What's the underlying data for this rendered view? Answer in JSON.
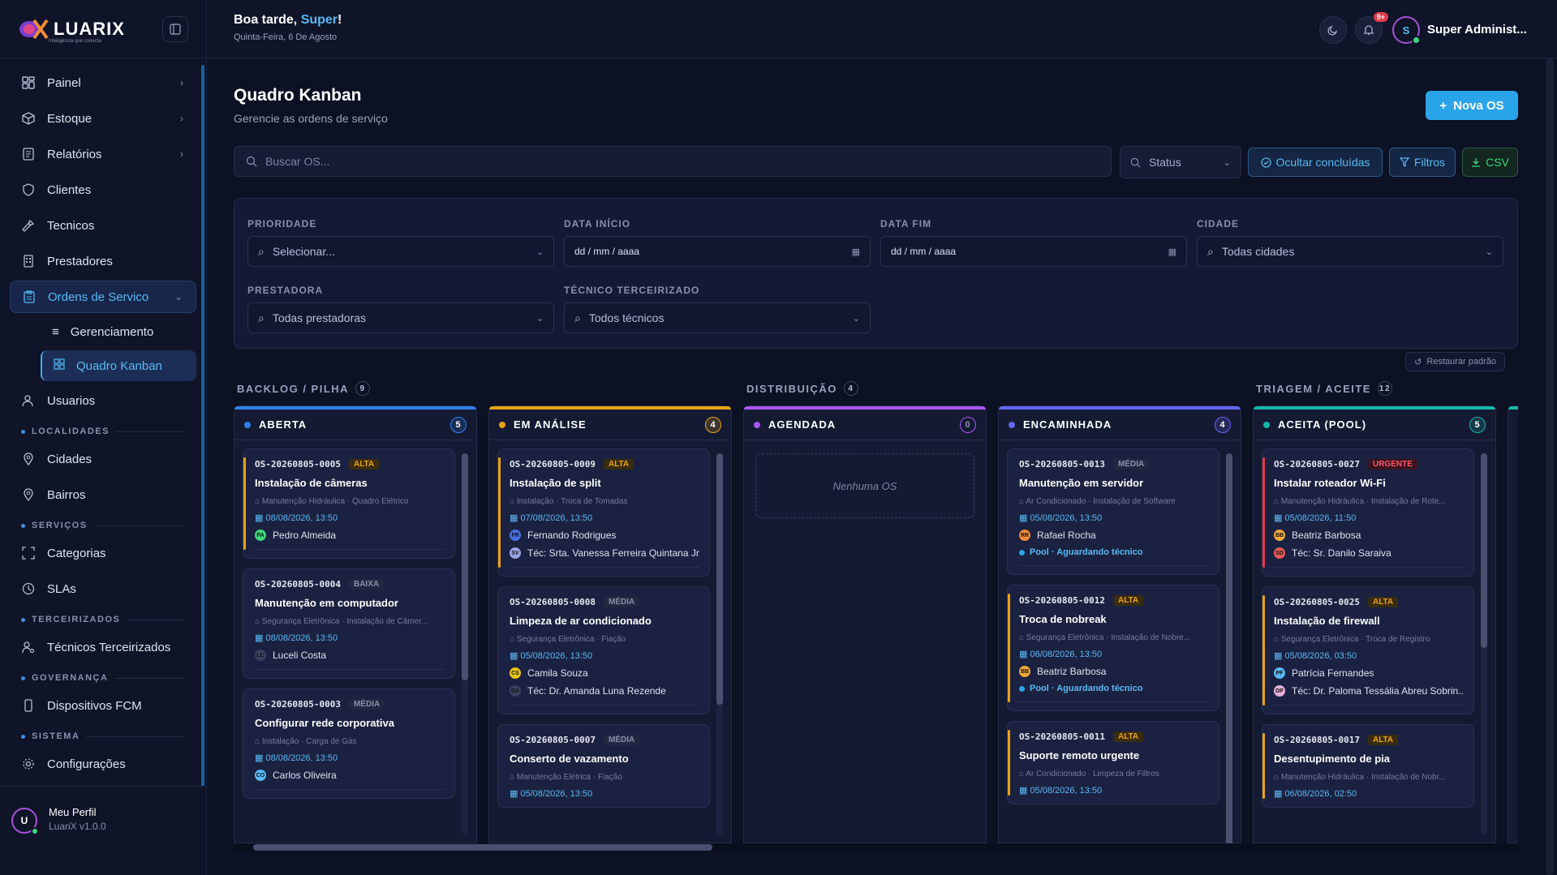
{
  "app": {
    "logo_text": "LUARIX",
    "logo_tagline": "Inteligência que conecta"
  },
  "header": {
    "greeting_prefix": "Boa tarde, ",
    "greeting_name": "Super",
    "greeting_suffix": "!",
    "date": "Quinta-Feira, 6 De Agosto",
    "notif_badge": "9+",
    "user_initial": "S",
    "user_name": "Super Administ..."
  },
  "sidebar": {
    "items": [
      {
        "label": "Painel",
        "icon": "dashboard-icon"
      },
      {
        "label": "Estoque",
        "icon": "box-icon"
      },
      {
        "label": "Relatórios",
        "icon": "report-icon"
      },
      {
        "label": "Clientes",
        "icon": "shield-icon"
      },
      {
        "label": "Tecnicos",
        "icon": "wrench-icon"
      },
      {
        "label": "Prestadores",
        "icon": "building-icon"
      },
      {
        "label": "Ordens de Servico",
        "icon": "clipboard-icon"
      }
    ],
    "subitems": [
      {
        "label": "Gerenciamento",
        "icon": "list-icon"
      },
      {
        "label": "Quadro Kanban",
        "icon": "kanban-icon"
      }
    ],
    "usuarios": "Usuarios",
    "sections": {
      "localidades": "LOCALIDADES",
      "servicos": "SERVIÇOS",
      "terceirizados": "TERCEIRIZADOS",
      "governanca": "GOVERNANÇA",
      "sistema": "SISTEMA"
    },
    "localidades_items": [
      "Cidades",
      "Bairros"
    ],
    "servicos_items": [
      "Categorias",
      "SLAs"
    ],
    "terceirizados_items": [
      "Técnicos Terceirizados"
    ],
    "governanca_items": [
      "Dispositivos FCM"
    ],
    "sistema_items": [
      "Configurações"
    ],
    "profile": {
      "initial": "U",
      "name": "Meu Perfil",
      "version": "LuariX v1.0.0"
    }
  },
  "page": {
    "title": "Quadro Kanban",
    "subtitle": "Gerencie as ordens de serviço",
    "new_button": "Nova OS",
    "search_placeholder": "Buscar OS...",
    "status_label": "Status",
    "hide_done": "Ocultar concluídas",
    "filters_btn": "Filtros",
    "csv_btn": "CSV",
    "restore": "Restaurar padrão"
  },
  "filters": {
    "prioridade": {
      "label": "PRIORIDADE",
      "value": "Selecionar..."
    },
    "data_inicio": {
      "label": "DATA INÍCIO",
      "value": "dd / mm / aaaa"
    },
    "data_fim": {
      "label": "DATA FIM",
      "value": "dd / mm / aaaa"
    },
    "cidade": {
      "label": "CIDADE",
      "value": "Todas cidades"
    },
    "prestadora": {
      "label": "PRESTADORA",
      "value": "Todas prestadoras"
    },
    "tecnico": {
      "label": "TÉCNICO TERCEIRIZADO",
      "value": "Todos técnicos"
    }
  },
  "groups": [
    {
      "label": "BACKLOG / PILHA",
      "count": "9"
    },
    {
      "label": "DISTRIBUIÇÃO",
      "count": "4"
    },
    {
      "label": "TRIAGEM / ACEITE",
      "count": "12"
    }
  ],
  "colors": {
    "accent": "#2aa4e9",
    "alta": "#e8a317",
    "urgente": "#e23b4a",
    "media": "#8a8fb0",
    "baixa": "#8a8fb0"
  },
  "columns": [
    {
      "title": "ABERTA",
      "count": "5",
      "color": "#2f80ed",
      "cards": [
        {
          "id": "OS-20260805-0005",
          "prio": "ALTA",
          "title": "Instalação de câmeras",
          "tags": "Manutenção Hidráulica · Quadro Elétrico",
          "date": "08/08/2026, 13:50",
          "person": "Pedro Almeida",
          "pinit": "PA",
          "pcolor": "#3ed67e"
        },
        {
          "id": "OS-20260805-0004",
          "prio": "BAIXA",
          "title": "Manutenção em computador",
          "tags": "Segurança Eletrônica · Instalação de Câmer...",
          "date": "08/08/2026, 13:50",
          "person": "Luceli Costa",
          "pinit": "LC",
          "pcolor": "#3b4060"
        },
        {
          "id": "OS-20260805-0003",
          "prio": "MÉDIA",
          "title": "Configurar rede corporativa",
          "tags": "Instalação · Carga de Gás",
          "date": "08/08/2026, 13:50",
          "person": "Carlos Oliveira",
          "pinit": "CO",
          "pcolor": "#5ab9f5"
        }
      ]
    },
    {
      "title": "EM ANÁLISE",
      "count": "4",
      "color": "#e8a317",
      "cards": [
        {
          "id": "OS-20260805-0009",
          "prio": "ALTA",
          "title": "Instalação de split",
          "tags": "Instalação · Troca de Tomadas",
          "date": "07/08/2026, 13:50",
          "person": "Fernando Rodrigues",
          "pinit": "FR",
          "pcolor": "#4a6ee0",
          "tec": "Téc: Srta. Vanessa Ferreira Quintana Jr.",
          "tinit": "SV",
          "tcolor": "#9aa6e8"
        },
        {
          "id": "OS-20260805-0008",
          "prio": "MÉDIA",
          "title": "Limpeza de ar condicionado",
          "tags": "Segurança Eletrônica · Fiação",
          "date": "05/08/2026, 13:50",
          "person": "Camila Souza",
          "pinit": "CS",
          "pcolor": "#e8c417",
          "tec": "Téc: Dr. Amanda Luna Rezende",
          "tinit": "DA",
          "tcolor": "#3b4060"
        },
        {
          "id": "OS-20260805-0007",
          "prio": "MÉDIA",
          "title": "Conserto de vazamento",
          "tags": "Manutenção Elétrica · Fiação",
          "date": "05/08/2026, 13:50",
          "person": "",
          "pinit": "",
          "pcolor": "#3b4060"
        }
      ]
    },
    {
      "title": "AGENDADA",
      "count": "0",
      "color": "#a855f7",
      "empty": "Nenhuma OS",
      "cards": []
    },
    {
      "title": "ENCAMINHADA",
      "count": "4",
      "color": "#6366f1",
      "cards": [
        {
          "id": "OS-20260805-0013",
          "prio": "MÉDIA",
          "title": "Manutenção em servidor",
          "tags": "Ar Condicionado · Instalação de Software",
          "date": "05/08/2026, 13:50",
          "person": "Rafael Rocha",
          "pinit": "RR",
          "pcolor": "#f08a3a",
          "pool": "Pool · Aguardando técnico"
        },
        {
          "id": "OS-20260805-0012",
          "prio": "ALTA",
          "title": "Troca de nobreak",
          "tags": "Segurança Eletrônica · Instalação de Nobre...",
          "date": "06/08/2026, 13:50",
          "person": "Beatriz Barbosa",
          "pinit": "BB",
          "pcolor": "#f0a83a",
          "pool": "Pool · Aguardando técnico"
        },
        {
          "id": "OS-20260805-0011",
          "prio": "ALTA",
          "title": "Suporte remoto urgente",
          "tags": "Ar Condicionado · Limpeza de Filtros",
          "date": "05/08/2026, 13:50",
          "person": "",
          "pinit": "",
          "pcolor": "#3b4060"
        }
      ]
    },
    {
      "title": "ACEITA (POOL)",
      "count": "5",
      "color": "#14b8a6",
      "cards": [
        {
          "id": "OS-20260805-0027",
          "prio": "URGENTE",
          "title": "Instalar roteador Wi-Fi",
          "tags": "Manutenção Hidráulica · Instalação de Rote...",
          "date": "05/08/2026, 11:50",
          "person": "Beatriz Barbosa",
          "pinit": "BB",
          "pcolor": "#f0a83a",
          "tec": "Téc: Sr. Danilo Saraiva",
          "tinit": "SD",
          "tcolor": "#e85a5a"
        },
        {
          "id": "OS-20260805-0025",
          "prio": "ALTA",
          "title": "Instalação de firewall",
          "tags": "Segurança Eletrônica · Troca de Registro",
          "date": "05/08/2026, 03:50",
          "person": "Patrícia Fernandes",
          "pinit": "PF",
          "pcolor": "#5ab9f5",
          "tec": "Téc: Dr. Paloma Tessália Abreu Sobrin...",
          "tinit": "DP",
          "tcolor": "#e8b0d8"
        },
        {
          "id": "OS-20260805-0017",
          "prio": "ALTA",
          "title": "Desentupimento de pia",
          "tags": "Manutenção Hidráulica · Instalação de Nobr...",
          "date": "06/08/2026, 02:50",
          "person": "",
          "pinit": "",
          "pcolor": "#3b4060"
        }
      ]
    }
  ]
}
